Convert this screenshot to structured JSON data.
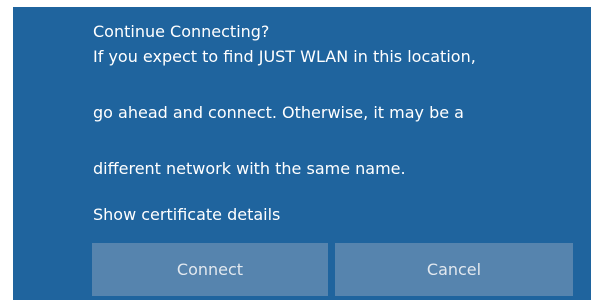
{
  "dialog": {
    "title": "Continue Connecting?",
    "message_lines": [
      "If you expect to find JUST WLAN in this location,",
      "go ahead and connect. Otherwise, it may be a",
      "different network with the same name."
    ],
    "link_label": "Show certificate details",
    "buttons": {
      "connect_label": "Connect",
      "cancel_label": "Cancel"
    }
  },
  "colors": {
    "panel_background": "#1f649e",
    "button_background": "#5684ae",
    "text": "#ffffff"
  }
}
